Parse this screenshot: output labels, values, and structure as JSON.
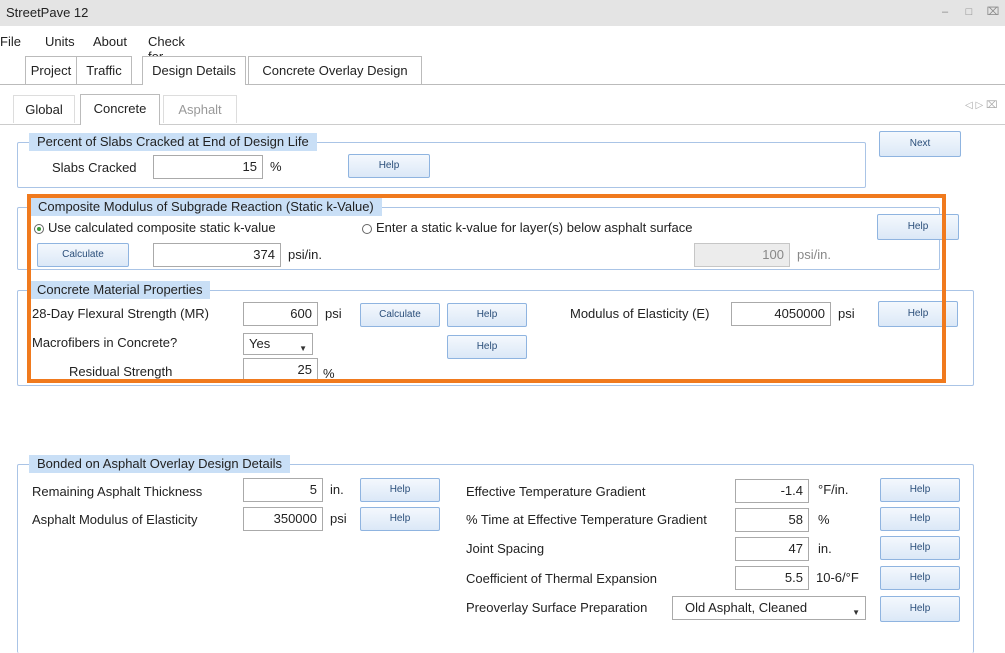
{
  "window": {
    "title": "StreetPave 12",
    "minimize": "–",
    "restore": "□",
    "close": "⌧"
  },
  "menu": [
    "File",
    "Units",
    "About",
    "Check for Updates"
  ],
  "tabs_main": [
    "Project",
    "Traffic",
    "Design Details",
    "Concrete Overlay Design"
  ],
  "tabs_sub": [
    "Global",
    "Concrete",
    "Asphalt"
  ],
  "tab_nav": "◁ ▷ ⌧",
  "slabs": {
    "title": "Percent of Slabs Cracked at End of Design Life",
    "label": "Slabs Cracked",
    "value": "15",
    "unit": "%",
    "help": "Help",
    "next": "Next"
  },
  "kvalue": {
    "title": "Composite Modulus of Subgrade Reaction (Static k-Value)",
    "opt1": "Use calculated composite static k-value",
    "opt2": "Enter a static k-value for layer(s) below asphalt surface",
    "calculate": "Calculate",
    "value": "374",
    "unit": "psi/in.",
    "static_value": "100",
    "static_unit": "psi/in.",
    "help": "Help"
  },
  "concrete": {
    "title": "Concrete Material Properties",
    "flex_label": "28-Day Flexural Strength (MR)",
    "flex_value": "600",
    "flex_unit": "psi",
    "calculate": "Calculate",
    "help1": "Help",
    "moe_label": "Modulus of Elasticity (E)",
    "moe_value": "4050000",
    "moe_unit": "psi",
    "help2": "Help",
    "macro_label": "Macrofibers in Concrete?",
    "macro_value": "Yes",
    "help3": "Help",
    "residual_label": "Residual Strength",
    "residual_value": "25",
    "residual_unit": "%"
  },
  "bonded": {
    "title": "Bonded on Asphalt Overlay Design Details",
    "rat_label": "Remaining Asphalt Thickness",
    "rat_value": "5",
    "rat_unit": "in.",
    "ame_label": "Asphalt Modulus of Elasticity",
    "ame_value": "350000",
    "ame_unit": "psi",
    "etg_label": "Effective Temperature Gradient",
    "etg_value": "-1.4",
    "etg_unit": "°F/in.",
    "pt_label": "% Time at Effective Temperature Gradient",
    "pt_value": "58",
    "pt_unit": "%",
    "js_label": "Joint Spacing",
    "js_value": "47",
    "js_unit": "in.",
    "cte_label": "Coefficient of Thermal Expansion",
    "cte_value": "5.5",
    "cte_unit": "10-6/°F",
    "psp_label": "Preoverlay Surface Preparation",
    "psp_value": "Old Asphalt, Cleaned",
    "help": "Help"
  }
}
